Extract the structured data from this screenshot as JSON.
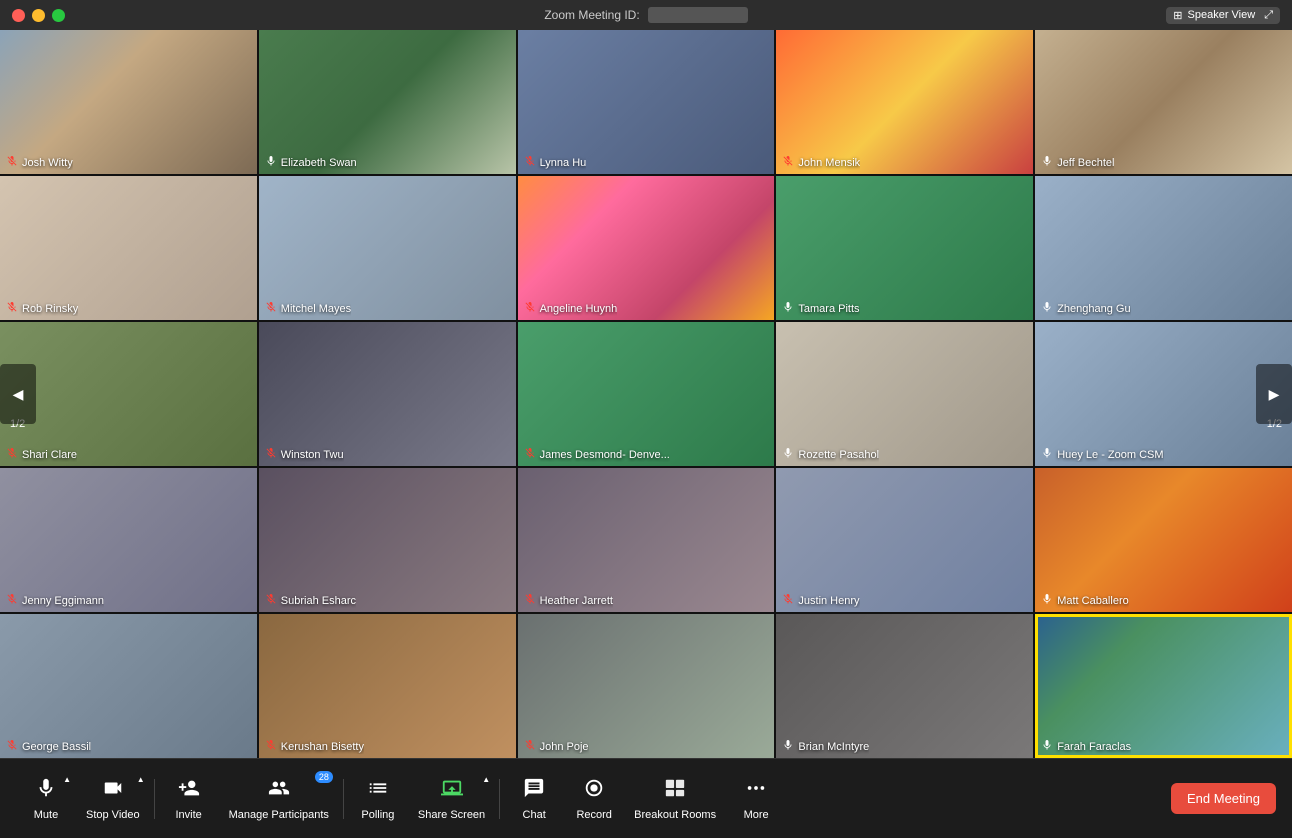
{
  "titleBar": {
    "meetingLabel": "Zoom Meeting ID:",
    "speakerViewLabel": "Speaker View"
  },
  "participants": [
    {
      "id": 1,
      "name": "Josh Witty",
      "muted": true,
      "bg": "bg-office-1"
    },
    {
      "id": 2,
      "name": "Elizabeth Swan",
      "muted": false,
      "bg": "bg-office-2"
    },
    {
      "id": 3,
      "name": "Lynna Hu",
      "muted": true,
      "bg": "bg-office-3"
    },
    {
      "id": 4,
      "name": "John Mensik",
      "muted": true,
      "bg": "bg-sunset"
    },
    {
      "id": 5,
      "name": "Jeff Bechtel",
      "muted": false,
      "bg": "bg-office-4"
    },
    {
      "id": 6,
      "name": "Rob Rinsky",
      "muted": true,
      "bg": "bg-baby"
    },
    {
      "id": 7,
      "name": "Mitchel Mayes",
      "muted": true,
      "bg": "bg-cubicle"
    },
    {
      "id": 8,
      "name": "Angeline Huynh",
      "muted": true,
      "bg": "bg-beach"
    },
    {
      "id": 9,
      "name": "Tamara Pitts",
      "muted": false,
      "bg": "bg-green"
    },
    {
      "id": 10,
      "name": "Zhenghang Gu",
      "muted": false,
      "bg": "bg-office-5"
    },
    {
      "id": 11,
      "name": "Shari Clare",
      "muted": true,
      "bg": "bg-office-6"
    },
    {
      "id": 12,
      "name": "Winston Twu",
      "muted": true,
      "bg": "bg-elevator"
    },
    {
      "id": 13,
      "name": "James Desmond- Denve...",
      "muted": true,
      "bg": "bg-green"
    },
    {
      "id": 14,
      "name": "Rozette Pasahol",
      "muted": false,
      "bg": "bg-office-7"
    },
    {
      "id": 15,
      "name": "Huey Le - Zoom CSM",
      "muted": false,
      "bg": "bg-office-5"
    },
    {
      "id": 16,
      "name": "Jenny Eggimann",
      "muted": true,
      "bg": "bg-office-lady"
    },
    {
      "id": 17,
      "name": "Subriah Esharc",
      "muted": true,
      "bg": "bg-dark-lady"
    },
    {
      "id": 18,
      "name": "Heather Jarrett",
      "muted": true,
      "bg": "bg-woman-stripes"
    },
    {
      "id": 19,
      "name": "Justin Henry",
      "muted": true,
      "bg": "bg-headphones"
    },
    {
      "id": 20,
      "name": "Matt Caballero",
      "muted": false,
      "bg": "bg-autumn"
    },
    {
      "id": 21,
      "name": "George Bassil",
      "muted": true,
      "bg": "bg-office-8"
    },
    {
      "id": 22,
      "name": "Kerushan Bisetty",
      "muted": true,
      "bg": "bg-brick"
    },
    {
      "id": 23,
      "name": "John Poje",
      "muted": true,
      "bg": "bg-man-red"
    },
    {
      "id": 24,
      "name": "Brian McIntyre",
      "muted": false,
      "bg": "bg-man-office"
    },
    {
      "id": 25,
      "name": "Farah Faraclas",
      "muted": false,
      "bg": "bg-mountain-lake",
      "highlighted": true
    }
  ],
  "toolbar": {
    "muteLabel": "Mute",
    "stopVideoLabel": "Stop Video",
    "inviteLabel": "Invite",
    "manageParticipantsLabel": "Manage Participants",
    "participantCount": "28",
    "pollingLabel": "Polling",
    "shareScreenLabel": "Share Screen",
    "chatLabel": "Chat",
    "recordLabel": "Record",
    "breakoutRoomsLabel": "Breakout Rooms",
    "moreLabel": "More",
    "endMeetingLabel": "End Meeting"
  },
  "navigation": {
    "leftPageLabel": "1/2",
    "rightPageLabel": "1/2"
  }
}
